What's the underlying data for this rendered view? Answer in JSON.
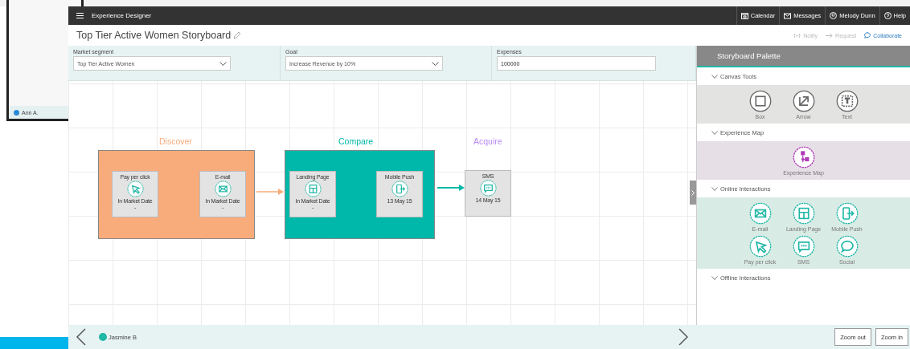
{
  "background_window": {
    "user": "Ann A."
  },
  "app_bar": {
    "title": "Experience Designer",
    "menu": [
      {
        "label": "Calendar"
      },
      {
        "label": "Messages"
      },
      {
        "label": "Melody Dunn"
      },
      {
        "label": "Help"
      }
    ]
  },
  "storyboard": {
    "title": "Top Tier Active Women Storyboard",
    "actions": [
      {
        "label": "Notify",
        "disabled": true
      },
      {
        "label": "Request",
        "disabled": true
      },
      {
        "label": "Collaborate",
        "disabled": false
      }
    ]
  },
  "filters": [
    {
      "kind": "select",
      "label": "Market segment",
      "value": "Top Tier Active Women"
    },
    {
      "kind": "select",
      "label": "Goal",
      "value": "Increase Revenue by 10%"
    },
    {
      "kind": "input",
      "label": "Expenses",
      "value": "100000"
    }
  ],
  "stages": [
    {
      "title": "Discover",
      "color": "#f8ab7b",
      "boxed": true,
      "cards": [
        {
          "kind": "cursor",
          "title": "Pay per click",
          "date": "In Market Date",
          "note": "-"
        },
        {
          "kind": "mail",
          "title": "E-mail",
          "date": "In Market Date",
          "note": "-"
        }
      ]
    },
    {
      "title": "Compare",
      "color": "#00b8a9",
      "boxed": true,
      "cards": [
        {
          "kind": "layout",
          "title": "Landing Page",
          "date": "In Market Date",
          "note": "-"
        },
        {
          "kind": "mobile",
          "title": "Mobile Push",
          "date": "13 May 15"
        }
      ]
    },
    {
      "title": "Acquire",
      "color": "#b98af0",
      "boxed": false,
      "cards": [
        {
          "kind": "sms",
          "title": "SMS",
          "date": "14 May 15"
        }
      ]
    }
  ],
  "palette": {
    "title": "Storyboard Palette",
    "sections": [
      {
        "title": "Canvas Tools",
        "expanded": true,
        "color": "#e3e3e1",
        "items": [
          {
            "kind": "box",
            "label": "Box"
          },
          {
            "kind": "arrow",
            "label": "Arrow"
          },
          {
            "kind": "text",
            "label": "Text"
          }
        ]
      },
      {
        "title": "Experience Map",
        "expanded": true,
        "color": "#e6dfe6",
        "items": [
          {
            "kind": "map",
            "label": "Experience Map"
          }
        ]
      },
      {
        "title": "Online Interactions",
        "expanded": true,
        "color": "#d9ebe5",
        "items": [
          {
            "kind": "mail",
            "label": "E-mail"
          },
          {
            "kind": "layout",
            "label": "Landing Page"
          },
          {
            "kind": "mobile",
            "label": "Mobile Push"
          },
          {
            "kind": "cursor",
            "label": "Pay per click"
          },
          {
            "kind": "sms",
            "label": "SMS"
          },
          {
            "kind": "social",
            "label": "Social"
          }
        ]
      },
      {
        "title": "Offline Interactions",
        "expanded": true
      }
    ]
  },
  "footer": {
    "user": "Jasmine B",
    "buttons": [
      "Zoom out",
      "Zoom in"
    ]
  }
}
